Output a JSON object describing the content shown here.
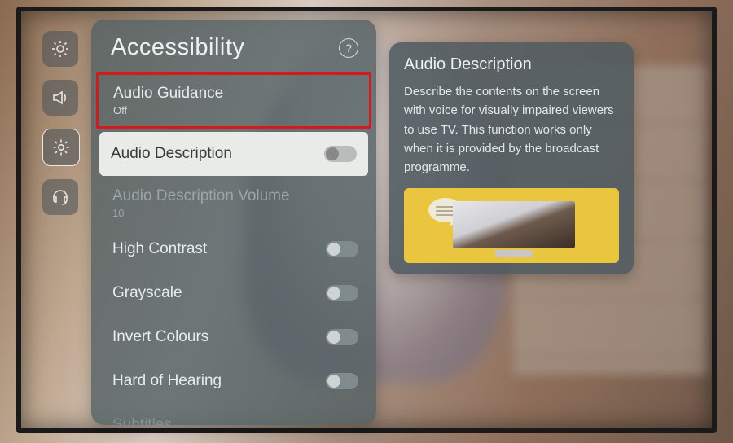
{
  "rail": {
    "items": [
      {
        "name": "brightness-icon"
      },
      {
        "name": "volume-icon"
      },
      {
        "name": "settings-icon",
        "active": true
      },
      {
        "name": "support-icon"
      }
    ]
  },
  "panel": {
    "title": "Accessibility",
    "help_glyph": "?",
    "rows": [
      {
        "label": "Audio Guidance",
        "sub": "Off",
        "highlight": true
      },
      {
        "label": "Audio Description",
        "toggle": true,
        "selected": true
      },
      {
        "label": "Audio Description Volume",
        "sub": "10",
        "dim": true
      },
      {
        "label": "High Contrast",
        "toggle": true
      },
      {
        "label": "Grayscale",
        "toggle": true
      },
      {
        "label": "Invert Colours",
        "toggle": true
      },
      {
        "label": "Hard of Hearing",
        "toggle": true
      },
      {
        "label": "Subtitles",
        "dim": true
      }
    ]
  },
  "card": {
    "title": "Audio Description",
    "text": "Describe the contents on the screen with voice for visually impaired viewers to use TV. This function works only when it is provided by the broadcast programme."
  }
}
